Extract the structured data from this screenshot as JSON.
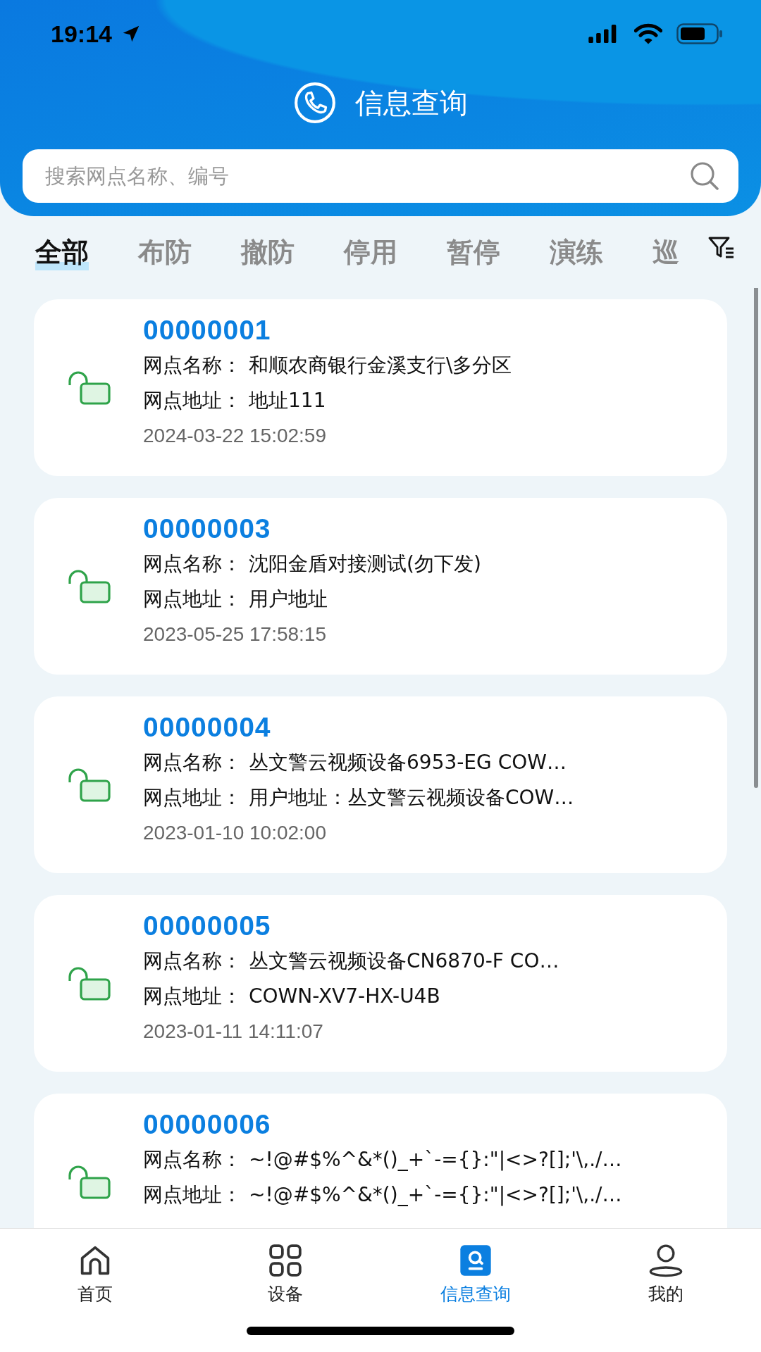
{
  "status_bar": {
    "time": "19:14"
  },
  "header": {
    "title": "信息查询"
  },
  "search": {
    "placeholder": "搜索网点名称、编号"
  },
  "tabs": [
    {
      "label": "全部",
      "selected": true
    },
    {
      "label": "布防",
      "selected": false
    },
    {
      "label": "撤防",
      "selected": false
    },
    {
      "label": "停用",
      "selected": false
    },
    {
      "label": "暂停",
      "selected": false
    },
    {
      "label": "演练",
      "selected": false
    },
    {
      "label": "巡",
      "selected": false
    }
  ],
  "cards": [
    {
      "code": "00000001",
      "fields": [
        {
          "label": "网点名称：",
          "value": "和顺农商银行金溪支行\\多分区"
        },
        {
          "label": "网点地址：",
          "value": "地址111"
        }
      ],
      "time": "2024-03-22 15:02:59"
    },
    {
      "code": "00000003",
      "fields": [
        {
          "label": "网点名称：",
          "value": "沈阳金盾对接测试(勿下发)"
        },
        {
          "label": "网点地址：",
          "value": "用户地址"
        }
      ],
      "time": "2023-05-25 17:58:15"
    },
    {
      "code": "00000004",
      "fields": [
        {
          "label": "网点名称：",
          "value": "丛文警云视频设备6953-EG COW…"
        },
        {
          "label": "网点地址：",
          "value": "用户地址：丛文警云视频设备COW…"
        }
      ],
      "time": "2023-01-10 10:02:00"
    },
    {
      "code": "00000005",
      "fields": [
        {
          "label": "网点名称：",
          "value": "丛文警云视频设备CN6870-F CO…"
        },
        {
          "label": "网点地址：",
          "value": "COWN-XV7-HX-U4B"
        }
      ],
      "time": "2023-01-11 14:11:07"
    },
    {
      "code": "00000006",
      "fields": [
        {
          "label": "网点名称：",
          "value": "~!@#$%^&*()_+`-={}:\"|<>?[];'\\,./…"
        },
        {
          "label": "网点地址：",
          "value": "~!@#$%^&*()_+`-={}:\"|<>?[];'\\,./…"
        }
      ]
    }
  ],
  "nav": [
    {
      "label": "首页",
      "kind": "home",
      "selected": false
    },
    {
      "label": "设备",
      "kind": "grid",
      "selected": false
    },
    {
      "label": "信息查询",
      "kind": "search",
      "selected": true
    },
    {
      "label": "我的",
      "kind": "user",
      "selected": false
    }
  ]
}
